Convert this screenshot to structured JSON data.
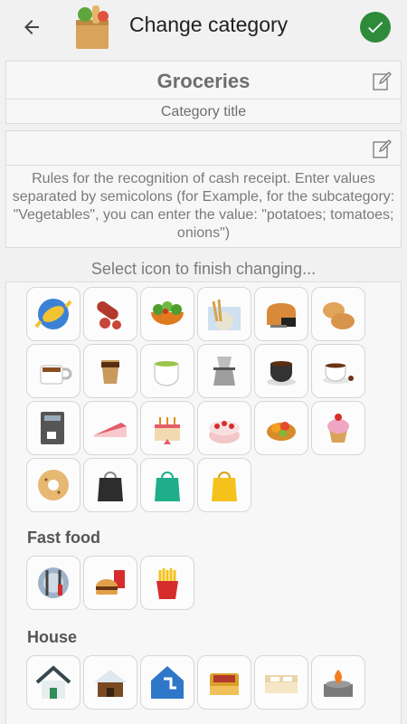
{
  "header": {
    "title": "Change category",
    "back_icon": "arrow-left-icon",
    "confirm_icon": "check-icon",
    "confirm_color": "#2e8b3a"
  },
  "category": {
    "name": "Groceries",
    "name_caption": "Category title"
  },
  "rules": {
    "text": "Rules for the recognition of cash receipt. Enter values separated by semicolons (for Example, for the subcategory: \"Vegetables\", you can enter the value: \"potatoes; tomatoes; onions\")"
  },
  "select_hint": "Select icon to finish changing...",
  "sections": [
    {
      "title": "",
      "icons": [
        "candy-icon",
        "sausage-icon",
        "salad-icon",
        "harvest-icon",
        "bread-icon",
        "buns-icon",
        "coffee-mug-icon",
        "latte-icon",
        "green-tea-icon",
        "moka-pot-icon",
        "coffee-cup-icon",
        "espresso-cup-icon",
        "coffee-machine-icon",
        "cake-slice-icon",
        "birthday-cake-icon",
        "strawberry-cake-icon",
        "fruit-tart-icon",
        "cupcake-icon",
        "donut-icon",
        "black-bag-icon",
        "green-bag-icon",
        "yellow-bag-icon"
      ]
    },
    {
      "title": "Fast food",
      "icons": [
        "cutlery-plate-icon",
        "burger-drink-icon",
        "fries-icon"
      ]
    },
    {
      "title": "House",
      "icons": [
        "house-icon",
        "snowy-house-icon",
        "house-plumbing-icon",
        "bed-icon",
        "double-bed-icon",
        "stove-fire-icon"
      ]
    }
  ]
}
